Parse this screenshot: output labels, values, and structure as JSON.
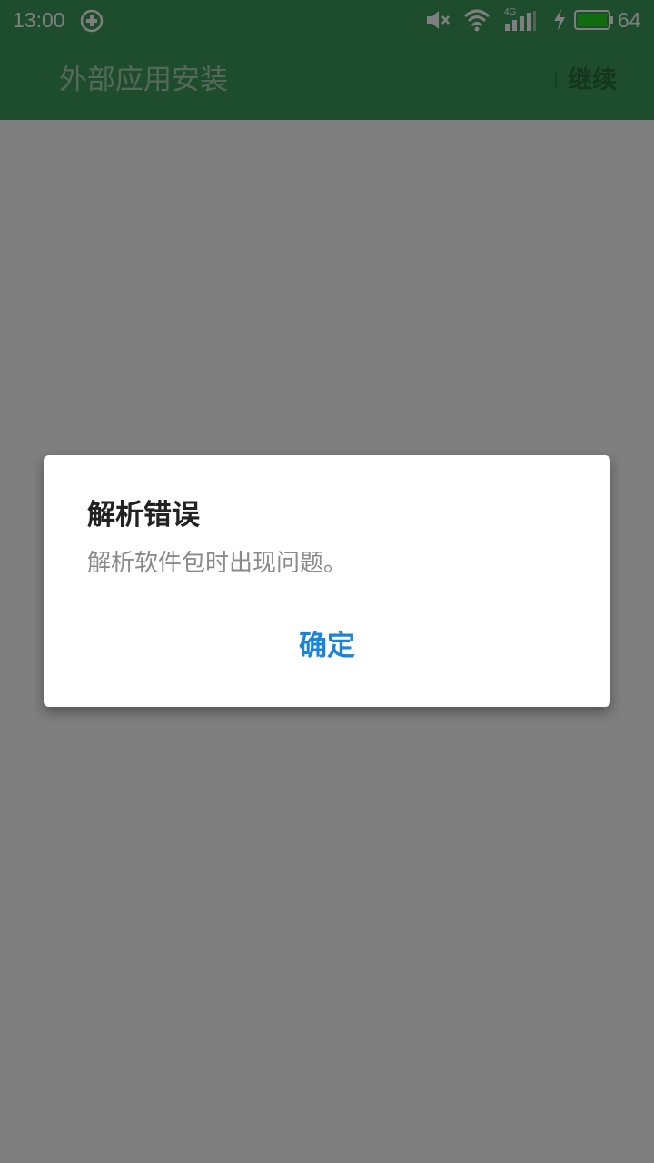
{
  "status_bar": {
    "time": "13:00",
    "battery_percent": "64",
    "battery_level": 0.64,
    "network_label": "4G",
    "icons": [
      "app-sync-icon",
      "mute-icon",
      "wifi-icon",
      "signal-icon",
      "charging-icon",
      "battery-icon"
    ]
  },
  "app_bar": {
    "title": "外部应用安装",
    "action_label": "继续"
  },
  "dialog": {
    "title": "解析错误",
    "message": "解析软件包时出现问题。",
    "confirm_label": "确定"
  },
  "colors": {
    "app_bar": "#3a9a5a",
    "dialog_button": "#1a84d8",
    "scrim": "rgba(0,0,0,0.5)"
  }
}
